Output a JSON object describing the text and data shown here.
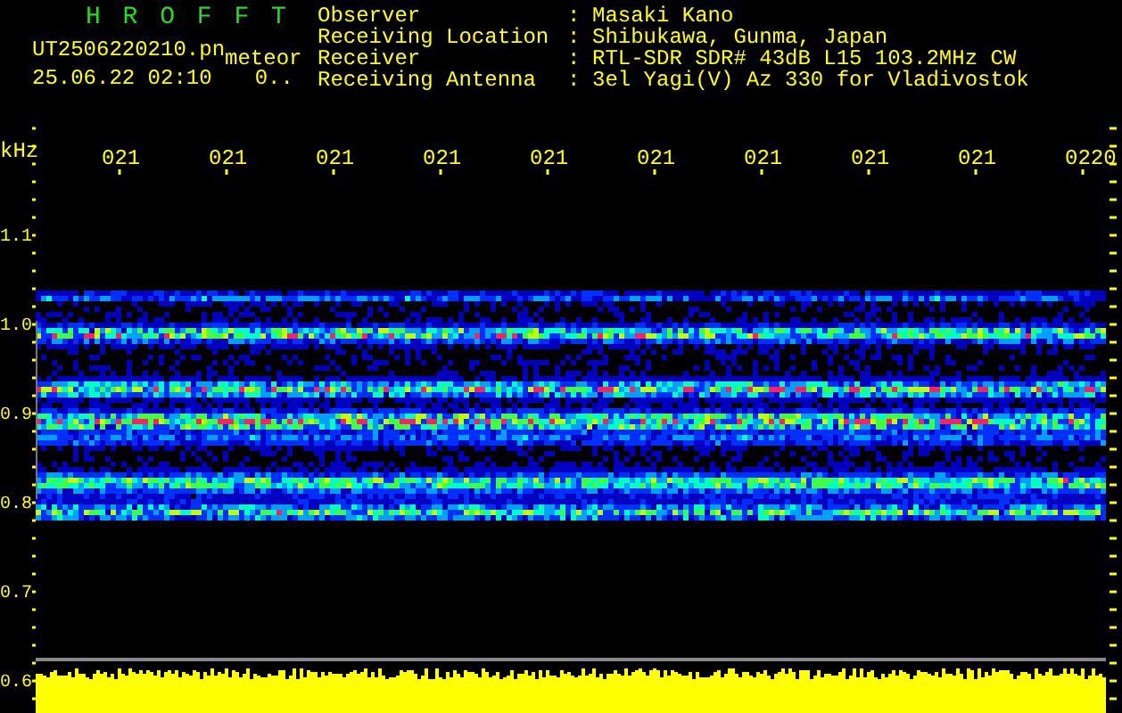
{
  "header": {
    "title": "H R O F F T",
    "file_name": "UT2506220210.pn",
    "tag": "meteor",
    "date_time": "25.06.22 02:10",
    "count": "0..",
    "info": [
      {
        "label": "Observer",
        "separator": ":",
        "value": "Masaki Kano"
      },
      {
        "label": "Receiving Location",
        "separator": ":",
        "value": "Shibukawa, Gunma, Japan"
      },
      {
        "label": "Receiver",
        "separator": ":",
        "value": "RTL-SDR SDR# 43dB L15 103.2MHz CW"
      },
      {
        "label": "Receiving Antenna",
        "separator": ":",
        "value": "3el Yagi(V) Az 330 for Vladivostok"
      }
    ]
  },
  "plot": {
    "unit": "kHz",
    "time_labels": [
      "021",
      "021",
      "021",
      "021",
      "021",
      "021",
      "021",
      "021",
      "021",
      "0220"
    ],
    "frequency_labels": [
      "1.1",
      "1.0",
      "0.9",
      "0.8",
      "0.7",
      "0.6"
    ]
  }
}
